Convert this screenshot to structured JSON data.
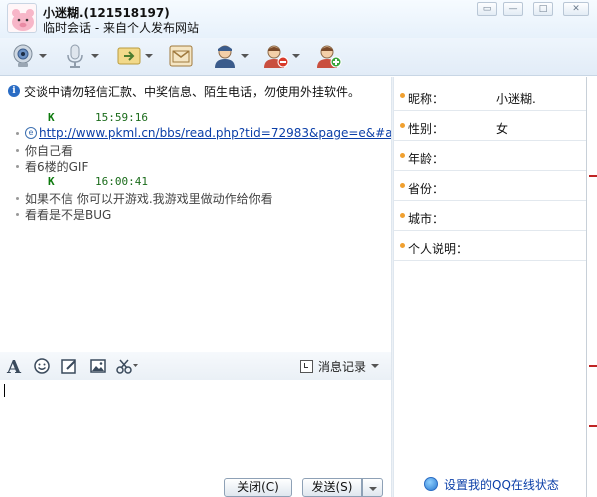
{
  "titlebar": {
    "contact_name": "小迷糊.(121518197)",
    "subtitle": "临时会话 - 来自个人发布网站"
  },
  "toolbar": {
    "items": [
      {
        "icon": "video-call-icon"
      },
      {
        "icon": "voice-call-icon"
      },
      {
        "icon": "send-file-icon"
      },
      {
        "icon": "send-mail-icon"
      },
      {
        "icon": "contact-info-icon"
      },
      {
        "icon": "block-user-icon"
      },
      {
        "icon": "add-friend-icon"
      }
    ]
  },
  "chat": {
    "notice": "交谈中请勿轻信汇款、中奖信息、陌生电话，勿使用外挂软件。",
    "messages": [
      {
        "sender": "K",
        "time": "15:59:16",
        "lines": [
          {
            "text": "http://www.pkml.cn/bbs/read.php?tid=72983&page=e&#a",
            "is_link": true
          },
          {
            "text": "你自己看",
            "is_link": false
          },
          {
            "text": "看6楼的GIF",
            "is_link": false
          }
        ]
      },
      {
        "sender": "K",
        "time": "16:00:41",
        "lines": [
          {
            "text": "如果不信 你可以开游戏.我游戏里做动作给你看",
            "is_link": false
          },
          {
            "text": "看看是不是BUG",
            "is_link": false
          }
        ]
      }
    ]
  },
  "input_toolbar": {
    "history_label": "消息记录"
  },
  "input": {
    "value": ""
  },
  "buttons": {
    "close_label": "关闭(C)",
    "send_label": "发送(S)"
  },
  "profile": {
    "fields": [
      {
        "label": "昵称：",
        "value": "小迷糊."
      },
      {
        "label": "性别：",
        "value": "女"
      },
      {
        "label": "年龄：",
        "value": ""
      },
      {
        "label": "省份：",
        "value": ""
      },
      {
        "label": "城市：",
        "value": ""
      },
      {
        "label": "个人说明：",
        "value": ""
      }
    ],
    "qq_status_link": "设置我的QQ在线状态"
  },
  "colors": {
    "accent": "#2a6cc4",
    "link": "#0b3fa8",
    "sender": "#0d7a0d",
    "bullet_orange": "#f0a030"
  }
}
